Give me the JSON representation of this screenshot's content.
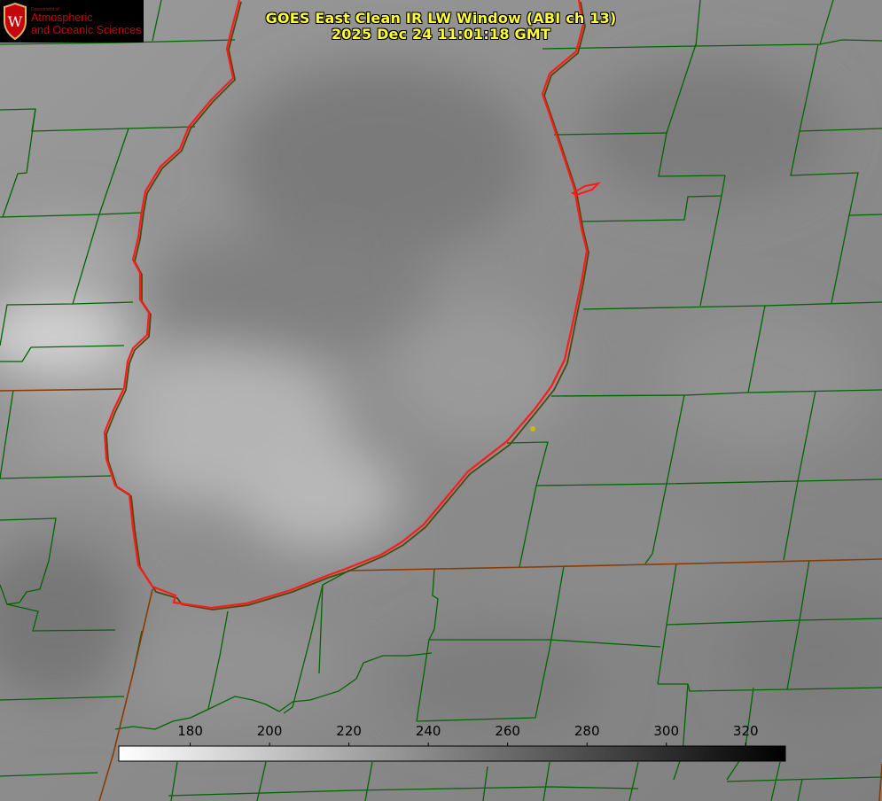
{
  "title": {
    "line1": "GOES East Clean IR LW Window (ABI ch 13)",
    "line2": "2025 Dec 24 11:01:18 GMT"
  },
  "logo": {
    "department": "Department of",
    "line1": "Atmospheric",
    "line2": "and Oceanic Sciences",
    "crest_letter": "W"
  },
  "colorbar": {
    "vmin": 162,
    "vmax": 330,
    "ticks": [
      180,
      200,
      220,
      240,
      260,
      280,
      300,
      320
    ],
    "tick_labels": [
      "180",
      "200",
      "220",
      "240",
      "260",
      "280",
      "300",
      "320"
    ]
  },
  "colors": {
    "county_lines": "#006600",
    "state_lines": "#8b3a00",
    "lake_outline": "#ff1a1a",
    "title_text": "#ffff33",
    "marker": "#ccbb00",
    "logo_red": "#c5050c"
  },
  "map": {
    "feature": "lake-outline",
    "marker": "city-marker"
  }
}
